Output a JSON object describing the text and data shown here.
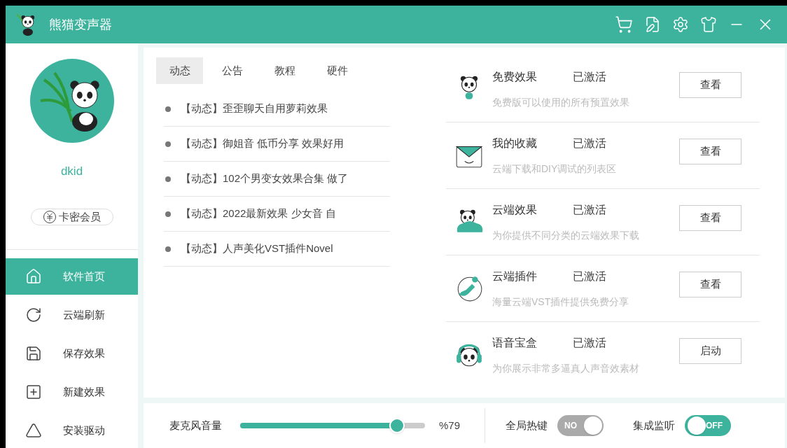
{
  "window": {
    "title": "熊猫变声器"
  },
  "user": {
    "name": "dkid",
    "member_button": "卡密会员"
  },
  "sidebar": {
    "items": [
      {
        "kind": "home",
        "label": "软件首页",
        "selected": true
      },
      {
        "kind": "refresh",
        "label": "云端刷新",
        "selected": false
      },
      {
        "kind": "save",
        "label": "保存效果",
        "selected": false
      },
      {
        "kind": "new",
        "label": "新建效果",
        "selected": false
      },
      {
        "kind": "driver",
        "label": "安装驱动",
        "selected": false
      }
    ]
  },
  "news": {
    "tabs": [
      {
        "label": "动态",
        "selected": true
      },
      {
        "label": "公告",
        "selected": false
      },
      {
        "label": "教程",
        "selected": false
      },
      {
        "label": "硬件",
        "selected": false
      }
    ],
    "items": [
      "【动态】歪歪聊天自用萝莉效果",
      "【动态】御姐音 低币分享 效果好用",
      "【动态】102个男变女效果合集 做了",
      "【动态】2022最新效果 少女音 自",
      "【动态】人声美化VST插件Novel"
    ]
  },
  "features": [
    {
      "kind": "bulb",
      "title": "免费效果",
      "status": "已激活",
      "description": "免费版可以使用的所有预置效果",
      "button": "查看"
    },
    {
      "kind": "envelope",
      "title": "我的收藏",
      "status": "已激活",
      "description": "云端下载和DIY调试的列表区",
      "button": "查看"
    },
    {
      "kind": "cloud",
      "title": "云端效果",
      "status": "已激活",
      "description": "为你提供不同分类的云端效果下载",
      "button": "查看"
    },
    {
      "kind": "plugin",
      "title": "云端插件",
      "status": "已激活",
      "description": "海量云端VST插件提供免费分享",
      "button": "查看"
    },
    {
      "kind": "headphones",
      "title": "语音宝盒",
      "status": "已激活",
      "description": "为你展示非常多逼真人声音效素材",
      "button": "启动"
    }
  ],
  "bottom_bar": {
    "mic_volume": {
      "label": "麦克风音量",
      "level": 0.85,
      "reading": "%79"
    },
    "toggles": [
      {
        "label": "全局热键",
        "on": true,
        "color": "#aaaaaa",
        "text": "NO"
      },
      {
        "label": "集成监听",
        "on": false,
        "color": "#3db39e",
        "text": "OFF"
      }
    ]
  }
}
